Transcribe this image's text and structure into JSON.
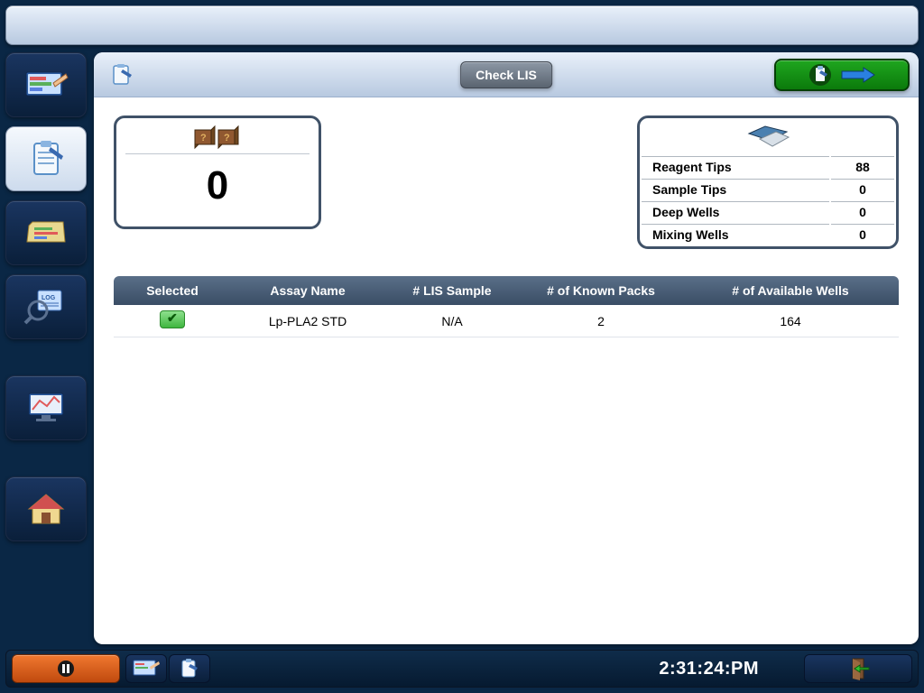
{
  "toolbar": {
    "check_lis_label": "Check LIS"
  },
  "sample_box": {
    "count": "0"
  },
  "tips_box": {
    "rows": [
      {
        "label": "Reagent Tips",
        "value": "88"
      },
      {
        "label": "Sample Tips",
        "value": "0"
      },
      {
        "label": "Deep Wells",
        "value": "0"
      },
      {
        "label": "Mixing Wells",
        "value": "0"
      }
    ]
  },
  "assay_table": {
    "headers": {
      "selected": "Selected",
      "assay_name": "Assay Name",
      "lis_sample": "# LIS Sample",
      "known_packs": "# of Known Packs",
      "avail_wells": "# of Available Wells"
    },
    "rows": [
      {
        "selected": true,
        "assay_name": "Lp-PLA2 STD",
        "lis_sample": "N/A",
        "known_packs": "2",
        "avail_wells": "164"
      }
    ]
  },
  "footer": {
    "clock": "2:31:24:PM"
  }
}
